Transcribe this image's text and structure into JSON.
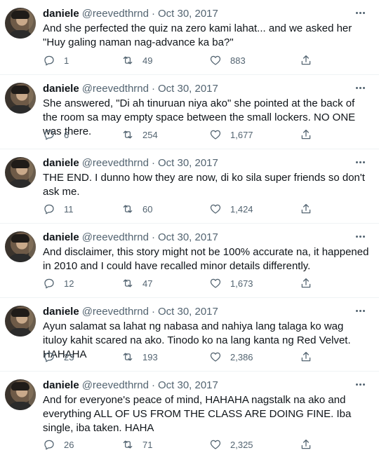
{
  "author": {
    "name": "daniele",
    "handle": "@reevedthrnd",
    "separator": "·",
    "date": "Oct 30, 2017"
  },
  "icons": {
    "avatar": "profile-photo",
    "more": "more-horizontal-icon",
    "reply": "reply-icon",
    "retweet": "retweet-icon",
    "like": "heart-icon",
    "share": "share-icon"
  },
  "colors": {
    "text": "#0f1419",
    "muted": "#536471",
    "divider": "#eff3f4"
  },
  "tweets": [
    {
      "text": "And she perfected the quiz na zero kami lahat... and we asked her \"Huy galing naman nag-advance ka ba?\"",
      "replies": "1",
      "retweets": "49",
      "likes": "883"
    },
    {
      "text": "She answered, \"Di ah tinuruan niya ako\" she pointed at the back of the room sa may empty space between the small lockers. NO ONE was there.",
      "replies": "6",
      "retweets": "254",
      "likes": "1,677"
    },
    {
      "text": "THE END. I dunno how they are now, di ko sila super friends so don't ask me.",
      "replies": "11",
      "retweets": "60",
      "likes": "1,424"
    },
    {
      "text": "And disclaimer, this story might not be 100% accurate na, it happened in 2010 and I could have recalled minor details differently.",
      "replies": "12",
      "retweets": "47",
      "likes": "1,673"
    },
    {
      "text": "Ayun salamat sa lahat ng nabasa and nahiya lang talaga ko wag ituloy kahit scared na ako. Tinodo ko na lang kanta ng Red Velvet. HAHAHA",
      "replies": "23",
      "retweets": "193",
      "likes": "2,386"
    },
    {
      "text": "And for everyone's peace of mind, HAHAHA nagstalk na ako and everything ALL OF US FROM THE CLASS ARE DOING FINE. Iba single, iba taken. HAHA",
      "replies": "26",
      "retweets": "71",
      "likes": "2,325"
    }
  ]
}
